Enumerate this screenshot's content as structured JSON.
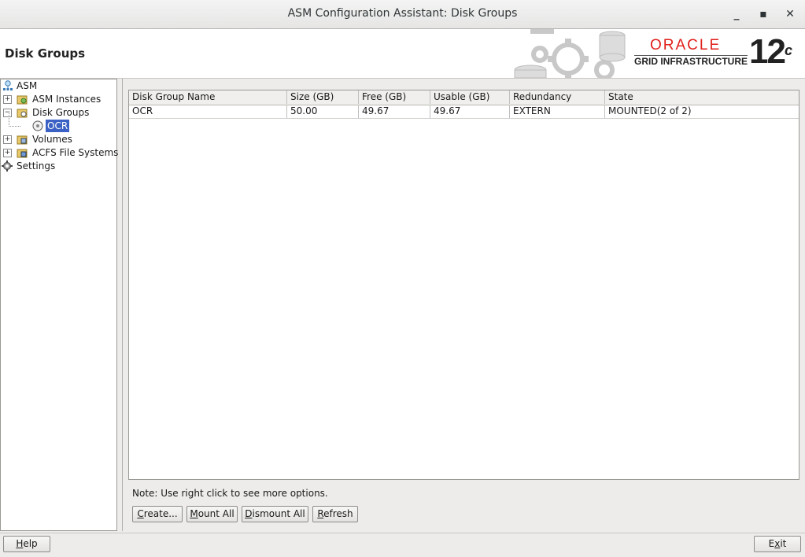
{
  "window": {
    "title": "ASM Configuration Assistant: Disk Groups"
  },
  "header": {
    "page_title": "Disk Groups",
    "brand_oracle": "ORACLE",
    "brand_product": "GRID INFRASTRUCTURE",
    "brand_version": "12",
    "brand_version_suffix": "c"
  },
  "tree": {
    "root": "ASM",
    "items": [
      "ASM Instances",
      "Disk Groups",
      "OCR",
      "Volumes",
      "ACFS File Systems",
      "Settings"
    ]
  },
  "table": {
    "columns": [
      "Disk Group Name",
      "Size (GB)",
      "Free (GB)",
      "Usable (GB)",
      "Redundancy",
      "State"
    ],
    "rows": [
      [
        "OCR",
        "50.00",
        "49.67",
        "49.67",
        "EXTERN",
        "MOUNTED(2 of 2)"
      ]
    ]
  },
  "note": "Note: Use right click to see more options.",
  "buttons": {
    "create": {
      "first": "C",
      "rest": "reate..."
    },
    "mount_all": {
      "first": "M",
      "rest": "ount All"
    },
    "dismount_all": {
      "first": "D",
      "rest": "ismount All"
    },
    "refresh": {
      "first": "R",
      "rest": "efresh"
    },
    "help": {
      "first": "H",
      "rest": "elp"
    },
    "exit": {
      "first": "E",
      "rest": "xit",
      "prefix": "E",
      "mid": "x",
      "suffix": "it"
    }
  },
  "colors": {
    "selection": "#3b61c4",
    "oracle_red": "#e0201b"
  }
}
